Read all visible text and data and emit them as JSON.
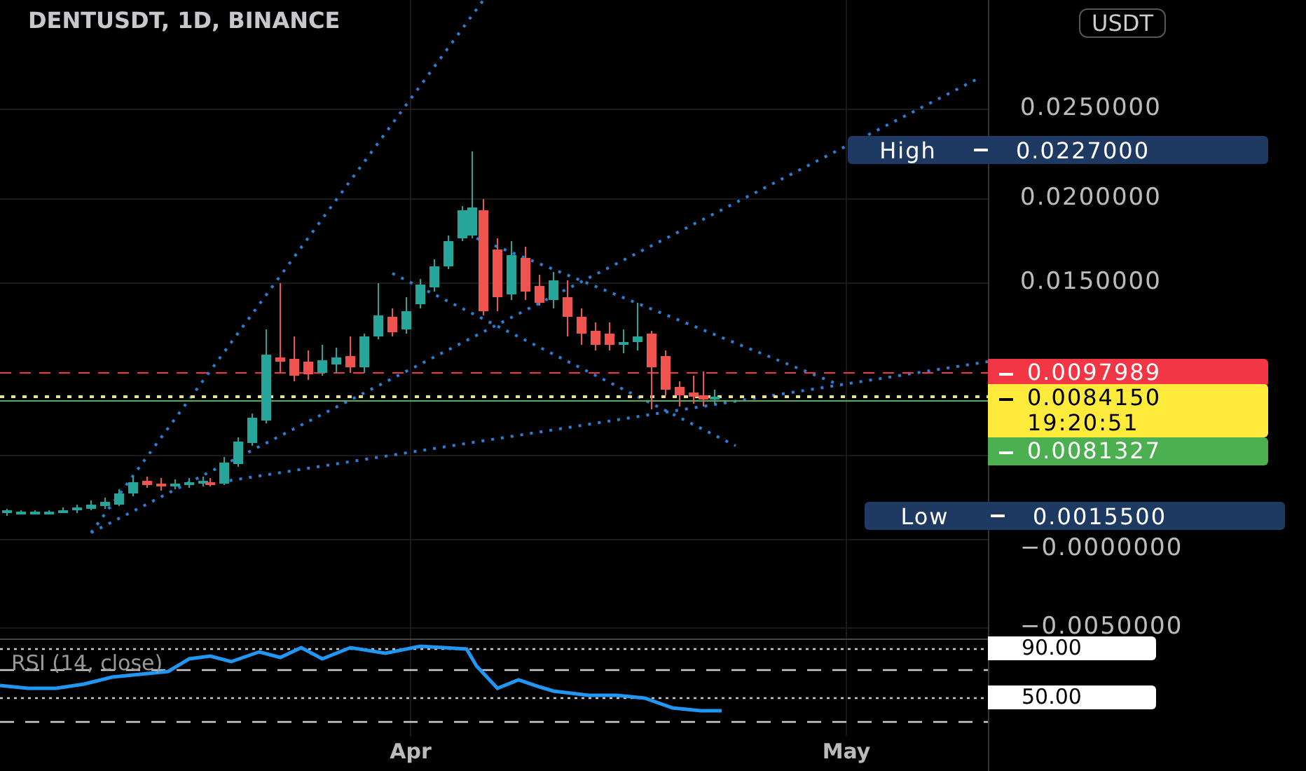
{
  "title": "DENTUSDT, 1D, BINANCE",
  "price_scale": {
    "currency": "USDT",
    "ticks": [
      "0.0250000",
      "0.0200000",
      "0.0150000",
      "−0.0000000",
      "−0.0050000"
    ]
  },
  "markers": [
    {
      "label": "High",
      "value": "0.0227000",
      "color": "#1e3a62"
    },
    {
      "label": "Low",
      "value": "0.0015500",
      "color": "#1e3a62"
    }
  ],
  "price_tags": [
    {
      "value": "0.0097989",
      "color": "#f23645"
    },
    {
      "value": "0.0084150",
      "countdown": "19:20:51",
      "color": "#ffeb3b"
    },
    {
      "value": "0.0081327",
      "color": "#4caf50"
    }
  ],
  "rsi": {
    "label": "RSI (14, close)",
    "levels": [
      "90.00",
      "50.00"
    ]
  },
  "x_axis": [
    "Apr",
    "May"
  ]
}
